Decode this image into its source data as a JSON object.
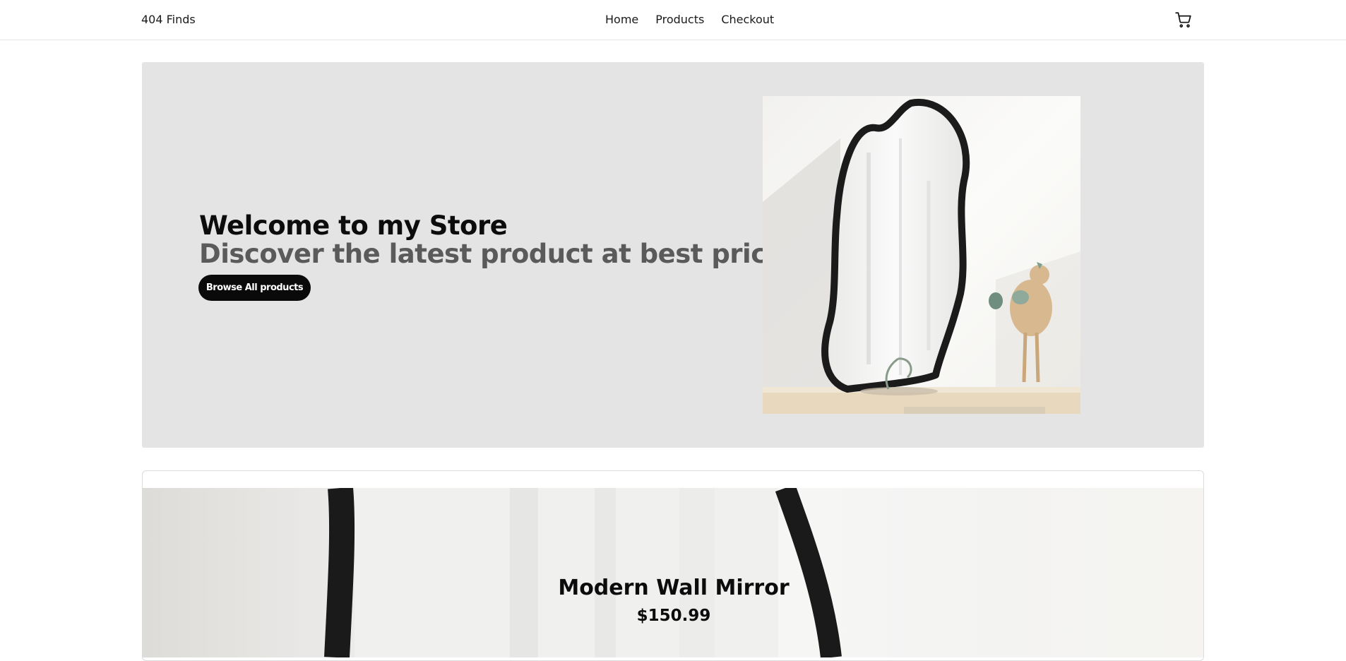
{
  "header": {
    "brand": "404 Finds",
    "nav": [
      "Home",
      "Products",
      "Checkout"
    ],
    "cart_icon": "shopping-cart-icon"
  },
  "hero": {
    "title": "Welcome to my Store",
    "subtitle": "Discover the latest product at best price",
    "button_label": "Browse All products",
    "image_subject": "wavy black mirror on shelf with decor",
    "background_color": "#e4e4e4"
  },
  "featured_product": {
    "name": "Modern Wall Mirror",
    "price": "$150.99"
  }
}
